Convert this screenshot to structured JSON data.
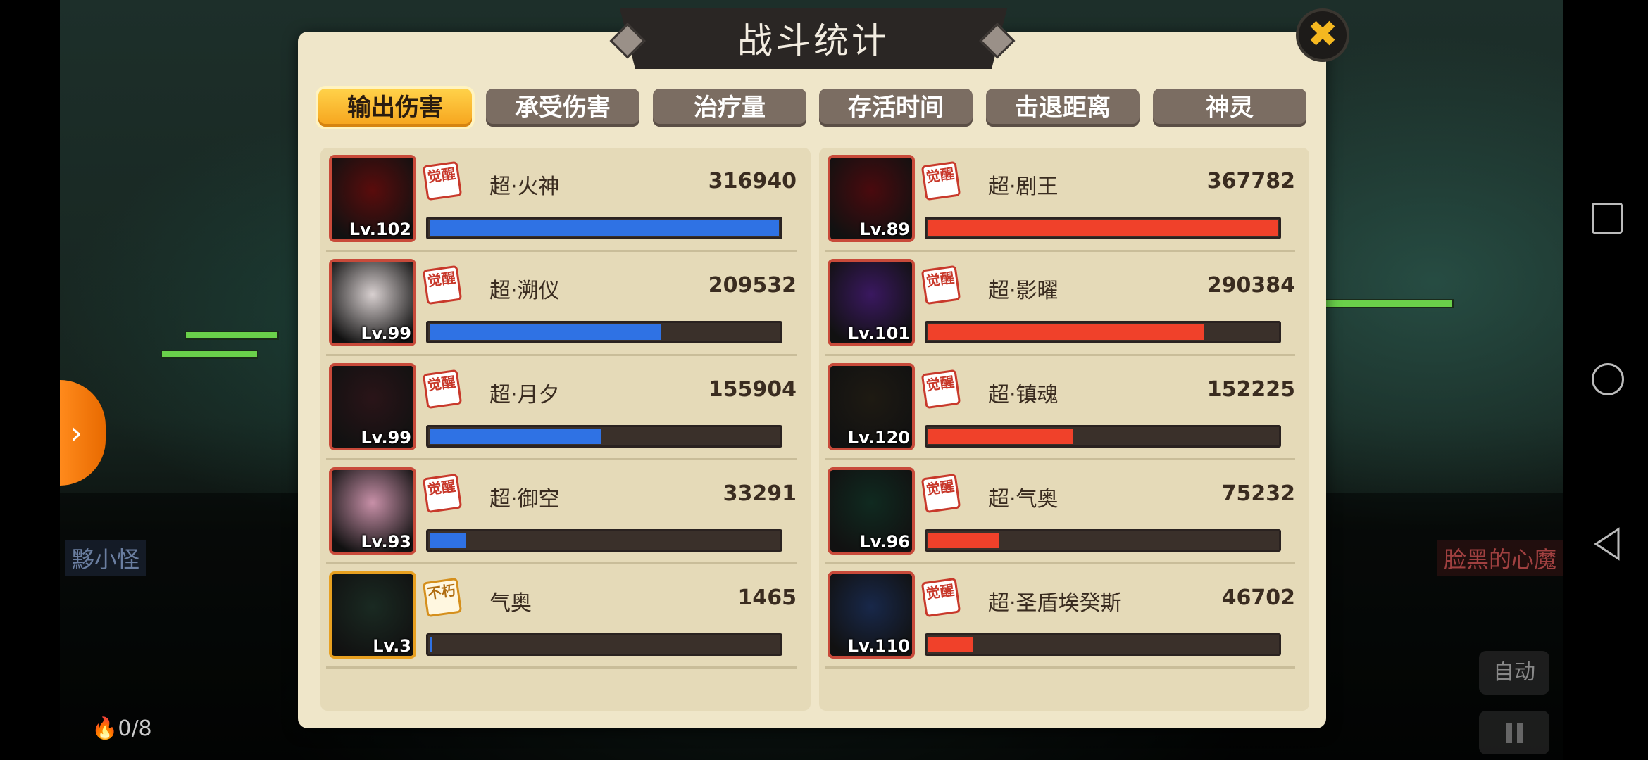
{
  "dialog": {
    "title": "战斗统计",
    "close_icon": "✖"
  },
  "tabs": [
    {
      "label": "输出伤害",
      "active": true
    },
    {
      "label": "承受伤害",
      "active": false
    },
    {
      "label": "治疗量",
      "active": false
    },
    {
      "label": "存活时间",
      "active": false
    },
    {
      "label": "击退距离",
      "active": false
    },
    {
      "label": "神灵",
      "active": false
    }
  ],
  "colors": {
    "left_bar": "#2f72e4",
    "right_bar": "#f0412a",
    "accent_tab": "#f6a31c"
  },
  "left_team": {
    "bar_max": 316940,
    "rows": [
      {
        "name": "超·火神",
        "value": "316940",
        "level": "Lv.102",
        "badge": "觉醒",
        "portrait_color": "#5a0c0c"
      },
      {
        "name": "超·溯仪",
        "value": "209532",
        "level": "Lv.99",
        "badge": "觉醒",
        "portrait_color": "#d8d0d0"
      },
      {
        "name": "超·月夕",
        "value": "155904",
        "level": "Lv.99",
        "badge": "觉醒",
        "portrait_color": "#2a1418"
      },
      {
        "name": "超·御空",
        "value": "33291",
        "level": "Lv.93",
        "badge": "觉醒",
        "portrait_color": "#c890a8"
      },
      {
        "name": "气奥",
        "value": "1465",
        "level": "Lv.3",
        "badge": "不朽",
        "portrait_color": "#1a2a22"
      }
    ]
  },
  "right_team": {
    "bar_max": 367782,
    "rows": [
      {
        "name": "超·剧王",
        "value": "367782",
        "level": "Lv.89",
        "badge": "觉醒",
        "portrait_color": "#4a0a0e"
      },
      {
        "name": "超·影曜",
        "value": "290384",
        "level": "Lv.101",
        "badge": "觉醒",
        "portrait_color": "#3a1860"
      },
      {
        "name": "超·镇魂",
        "value": "152225",
        "level": "Lv.120",
        "badge": "觉醒",
        "portrait_color": "#1e1a12"
      },
      {
        "name": "超·气奥",
        "value": "75232",
        "level": "Lv.96",
        "badge": "觉醒",
        "portrait_color": "#102a20"
      },
      {
        "name": "超·圣盾埃癸斯",
        "value": "46702",
        "level": "Lv.110",
        "badge": "觉醒",
        "portrait_color": "#18284a"
      }
    ]
  },
  "battle": {
    "enemy_left": "黟小怪",
    "enemy_right": "脸黑的心魔",
    "energy": "0/8",
    "auto_label": "自动"
  }
}
